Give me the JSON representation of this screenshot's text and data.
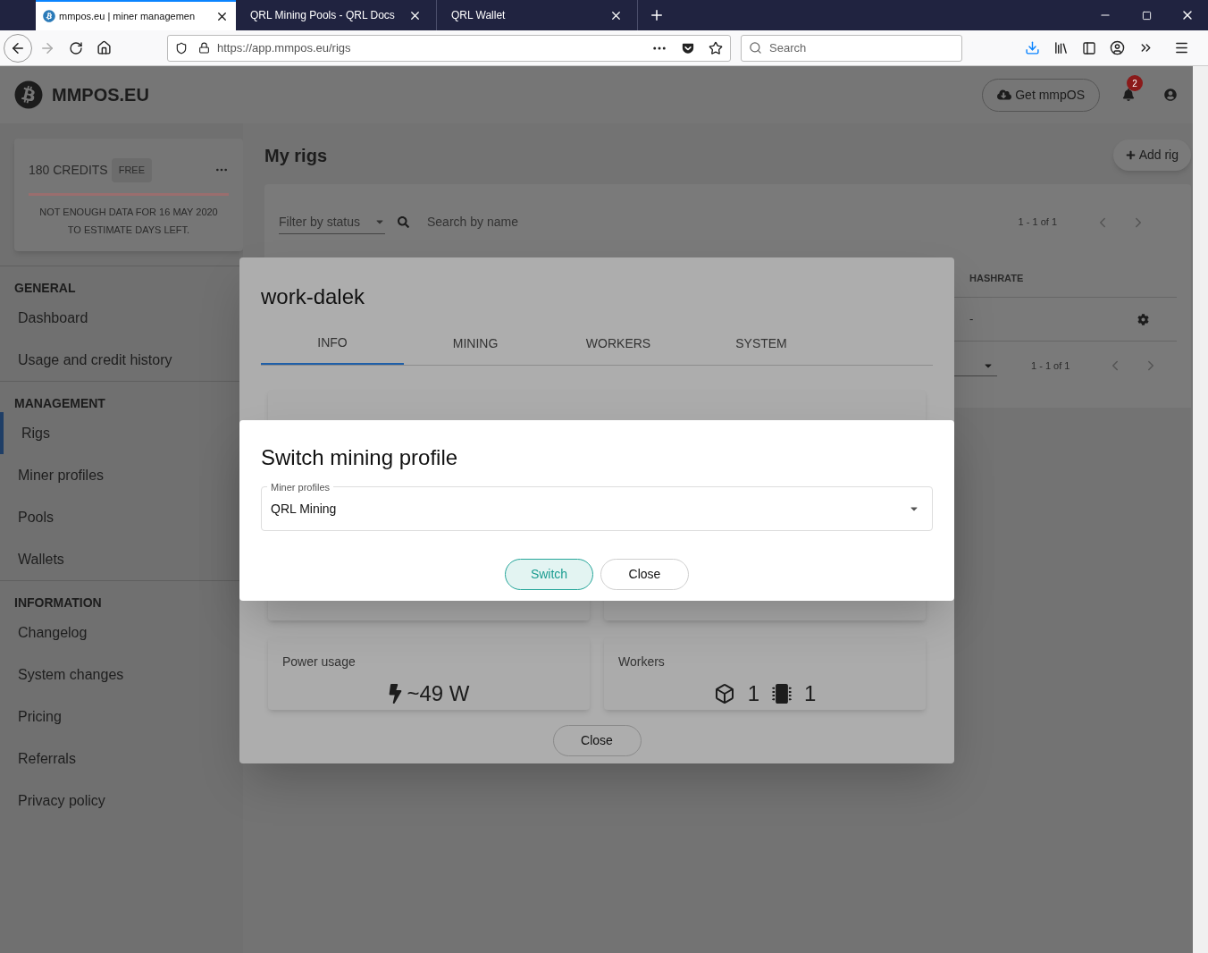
{
  "browser": {
    "tabs": [
      {
        "title": "mmpos.eu | miner managemen",
        "selected": true
      },
      {
        "title": "QRL Mining Pools - QRL Docs",
        "selected": false
      },
      {
        "title": "QRL Wallet",
        "selected": false
      }
    ],
    "url": "https://app.mmpos.eu/rigs",
    "search_placeholder": "Search"
  },
  "header": {
    "logo_text": "MMPOS.EU",
    "get_button": "Get mmpOS",
    "notification_count": "2"
  },
  "sidebar": {
    "credits": "180 CREDITS",
    "plan": "FREE",
    "notice": "NOT ENOUGH DATA FOR 16 MAY 2020 TO ESTIMATE DAYS LEFT.",
    "sections": [
      {
        "heading": "GENERAL",
        "items": [
          {
            "label": "Dashboard",
            "selected": false
          },
          {
            "label": "Usage and credit history",
            "selected": false
          }
        ]
      },
      {
        "heading": "MANAGEMENT",
        "items": [
          {
            "label": "Rigs",
            "selected": true
          },
          {
            "label": "Miner profiles",
            "selected": false
          },
          {
            "label": "Pools",
            "selected": false
          },
          {
            "label": "Wallets",
            "selected": false
          }
        ]
      },
      {
        "heading": "INFORMATION",
        "items": [
          {
            "label": "Changelog",
            "selected": false
          },
          {
            "label": "System changes",
            "selected": false
          },
          {
            "label": "Pricing",
            "selected": false
          },
          {
            "label": "Referrals",
            "selected": false
          },
          {
            "label": "Privacy policy",
            "selected": false
          }
        ]
      }
    ]
  },
  "main": {
    "title": "My rigs",
    "add_button": "Add rig",
    "filter_placeholder": "Filter by status",
    "search_placeholder": "Search by name",
    "pagination_top": "1 - 1 of 1",
    "column": "HASHRATE",
    "cell": "-",
    "pagination_bottom": "1 - 1 of 1"
  },
  "rig_dialog": {
    "title": "work-dalek",
    "tabs": [
      {
        "label": "INFO",
        "selected": true
      },
      {
        "label": "MINING",
        "selected": false
      },
      {
        "label": "WORKERS",
        "selected": false
      },
      {
        "label": "SYSTEM",
        "selected": false
      }
    ],
    "stats": [
      {
        "kind": "power",
        "label": "Power usage",
        "value": "~49 W"
      },
      {
        "kind": "workers",
        "label": "Workers",
        "gpu_count": "1",
        "cpu_count": "1"
      }
    ],
    "close": "Close"
  },
  "switch_dialog": {
    "title": "Switch mining profile",
    "field_label": "Miner profiles",
    "value": "QRL Mining",
    "buttons": [
      {
        "label": "Switch",
        "kind": "primary"
      },
      {
        "label": "Close",
        "kind": "secondary"
      }
    ]
  }
}
